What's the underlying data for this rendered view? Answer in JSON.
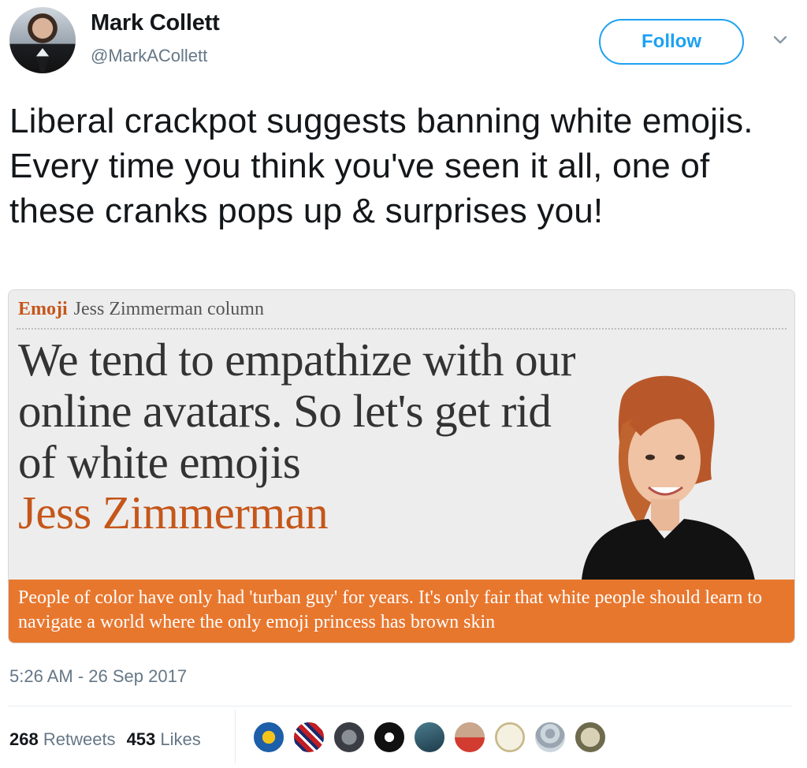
{
  "author": {
    "display_name": "Mark Collett",
    "handle": "@MarkACollett"
  },
  "follow_label": "Follow",
  "tweet": {
    "text": "Liberal crackpot suggests banning white emojis. Every time you think you've seen it all, one of these cranks pops up & surprises you!"
  },
  "card": {
    "section": "Emoji",
    "series": "Jess Zimmerman column",
    "headline": "We tend to empathize with our online avatars. So let's get rid of white emojis",
    "byline": "Jess Zimmerman",
    "standfirst": "People of color have only had 'turban guy' for years. It's only fair that white people should learn to navigate a world where the only emoji princess has brown skin"
  },
  "timestamp": "5:26 AM - 26 Sep 2017",
  "stats": {
    "retweets_count": "268",
    "retweets_label": "Retweets",
    "likes_count": "453",
    "likes_label": "Likes"
  },
  "colors": {
    "twitter_blue": "#1da1f2",
    "guardian_orange": "#e8772e",
    "guardian_kicker": "#c5561a",
    "meta_gray": "#657786"
  },
  "liker_avatars": [
    "liker-avatar-1",
    "liker-avatar-2",
    "liker-avatar-3",
    "liker-avatar-4",
    "liker-avatar-5",
    "liker-avatar-6",
    "liker-avatar-7",
    "liker-avatar-8",
    "liker-avatar-9"
  ]
}
